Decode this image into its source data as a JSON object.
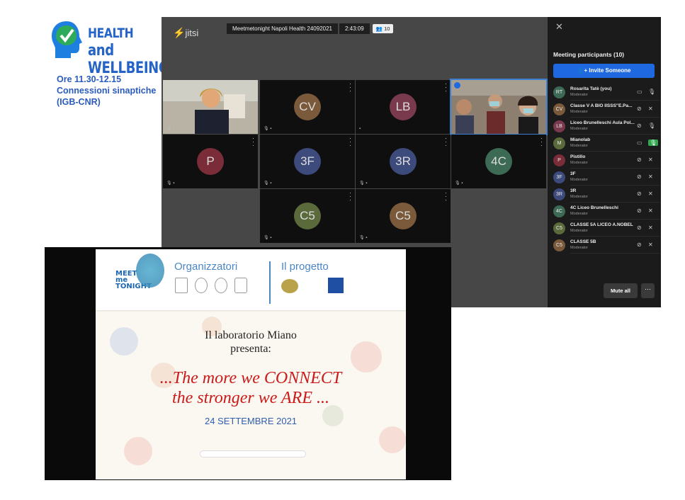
{
  "brand": {
    "line1": "HEALTH",
    "line2": "and WELLBEING",
    "color": "#2563c9",
    "check_color": "#2eab5a"
  },
  "info": {
    "line1": "Ore 11.30-12.15",
    "line2": "Connessioni sinaptiche",
    "line3": "(IGB-CNR)"
  },
  "jitsi": {
    "logo": "jitsi",
    "meeting_title": "Meetmetonight Napoli Health 24092021",
    "timer": "2:43:09",
    "participant_count": "10"
  },
  "tiles": [
    {
      "initials": "",
      "video": true
    },
    {
      "initials": "CV",
      "color": "#7a5a3a"
    },
    {
      "initials": "LB",
      "color": "#7a3a4e"
    },
    {
      "initials": "",
      "video": true,
      "selected": true
    },
    {
      "initials": "P",
      "color": "#7a2d38"
    },
    {
      "initials": "3F",
      "color": "#3c4a7c"
    },
    {
      "initials": "3R",
      "color": "#3c4a7c"
    },
    {
      "initials": "4C",
      "color": "#3c6a55"
    },
    {
      "initials": "C5",
      "color": "#5a6a3a"
    },
    {
      "initials": "C5",
      "color": "#7a5a3a"
    }
  ],
  "sidebar": {
    "title": "Meeting participants (10)",
    "invite_label": "Invite Someone",
    "participants": [
      {
        "initials": "RT",
        "name": "Rosarita Tatè (you)",
        "role": "Moderator",
        "color": "#3c6a55"
      },
      {
        "initials": "CV",
        "name": "Classe V A BIO IISSS\"E.Pa...",
        "role": "Moderator",
        "color": "#7a5a3a"
      },
      {
        "initials": "LB",
        "name": "Liceo Brunelleschi Aula Pol...",
        "role": "Moderator",
        "color": "#7a3a4e"
      },
      {
        "initials": "M",
        "name": "Mianolab",
        "role": "Moderator",
        "color": "#5a6a3a",
        "mic_active": true
      },
      {
        "initials": "P",
        "name": "Pistillo",
        "role": "Moderator",
        "color": "#7a2d38"
      },
      {
        "initials": "3F",
        "name": "3F",
        "role": "Moderator",
        "color": "#3c4a7c"
      },
      {
        "initials": "3R",
        "name": "3R",
        "role": "Moderator",
        "color": "#3c4a7c"
      },
      {
        "initials": "4C",
        "name": "4C Liceo Brunelleschi",
        "role": "Moderator",
        "color": "#3c6a55"
      },
      {
        "initials": "C5",
        "name": "CLASSE 5A LICEO A.NOBEL",
        "role": "Moderator",
        "color": "#5a6a3a"
      },
      {
        "initials": "C5",
        "name": "CLASSE 5B",
        "role": "Moderator",
        "color": "#7a5a3a"
      }
    ],
    "mute_all_label": "Mute all",
    "more_label": "⋯"
  },
  "slide": {
    "logo_text": "MEET me TONIGHT",
    "organizers": "Organizzatori",
    "project": "Il progetto",
    "line1": "Il laboratorio Miano",
    "line2": "presenta:",
    "big1": "...The more we CONNECT",
    "big2": "the stronger we ARE ...",
    "date": "24 SETTEMBRE 2021"
  }
}
